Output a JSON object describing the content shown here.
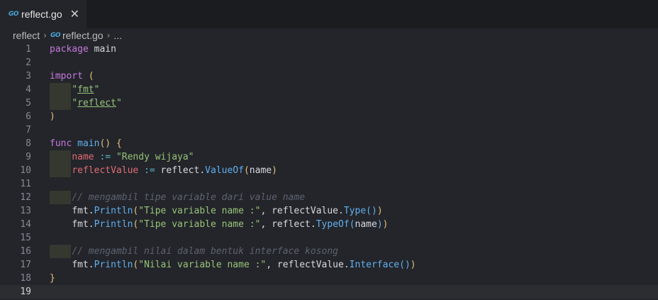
{
  "tab": {
    "icon": "go-icon",
    "icon_text": "GO",
    "title": "reflect.go",
    "close": "✕"
  },
  "breadcrumb": {
    "folder": "reflect",
    "sep": "›",
    "file_icon_text": "GO",
    "file": "reflect.go",
    "more": "..."
  },
  "editor": {
    "line_numbers": [
      "1",
      "2",
      "3",
      "4",
      "5",
      "6",
      "7",
      "8",
      "9",
      "10",
      "11",
      "12",
      "13",
      "14",
      "15",
      "16",
      "17",
      "18",
      "19"
    ],
    "l1": {
      "kw": "package",
      "rest": " main"
    },
    "l3": {
      "kw": "import",
      "paren": "("
    },
    "l4": {
      "q1": "\"",
      "s": "fmt",
      "q2": "\""
    },
    "l5": {
      "q1": "\"",
      "s": "reflect",
      "q2": "\""
    },
    "l6": {
      "paren": ")"
    },
    "l8": {
      "kw": "func",
      "name": "main",
      "paren": "()",
      "brace": "{"
    },
    "l9": {
      "v": "name",
      "op": ":=",
      "s": "\"Rendy wijaya\""
    },
    "l10": {
      "v": "reflectValue",
      "op": ":=",
      "pkg": "reflect.",
      "fn": "ValueOf",
      "p1": "(",
      "arg": "name",
      "p2": ")"
    },
    "l12": {
      "cmt": "// mengambil tipe variable dari value name"
    },
    "l13": {
      "pkg": "fmt.",
      "fn": "Println",
      "p1": "(",
      "s": "\"Tipe variable name :\"",
      "mid": ", reflectValue.",
      "fn2": "Type",
      "p2": "()",
      "p3": ")"
    },
    "l14": {
      "pkg": "fmt.",
      "fn": "Println",
      "p1": "(",
      "s": "\"Tipe variable name :\"",
      "mid": ", reflect.",
      "fn2": "TypeOf",
      "p2": "(",
      "arg": "name",
      "p3": ")",
      "p4": ")"
    },
    "l16": {
      "cmt": "// mengambil nilai dalam bentuk interface kosong"
    },
    "l17": {
      "pkg": "fmt.",
      "fn": "Println",
      "p1": "(",
      "s": "\"Nilai variable name :\"",
      "mid": ", reflectValue.",
      "fn2": "Interface",
      "p2": "()",
      "p3": ")"
    },
    "l18": {
      "brace": "}"
    }
  }
}
